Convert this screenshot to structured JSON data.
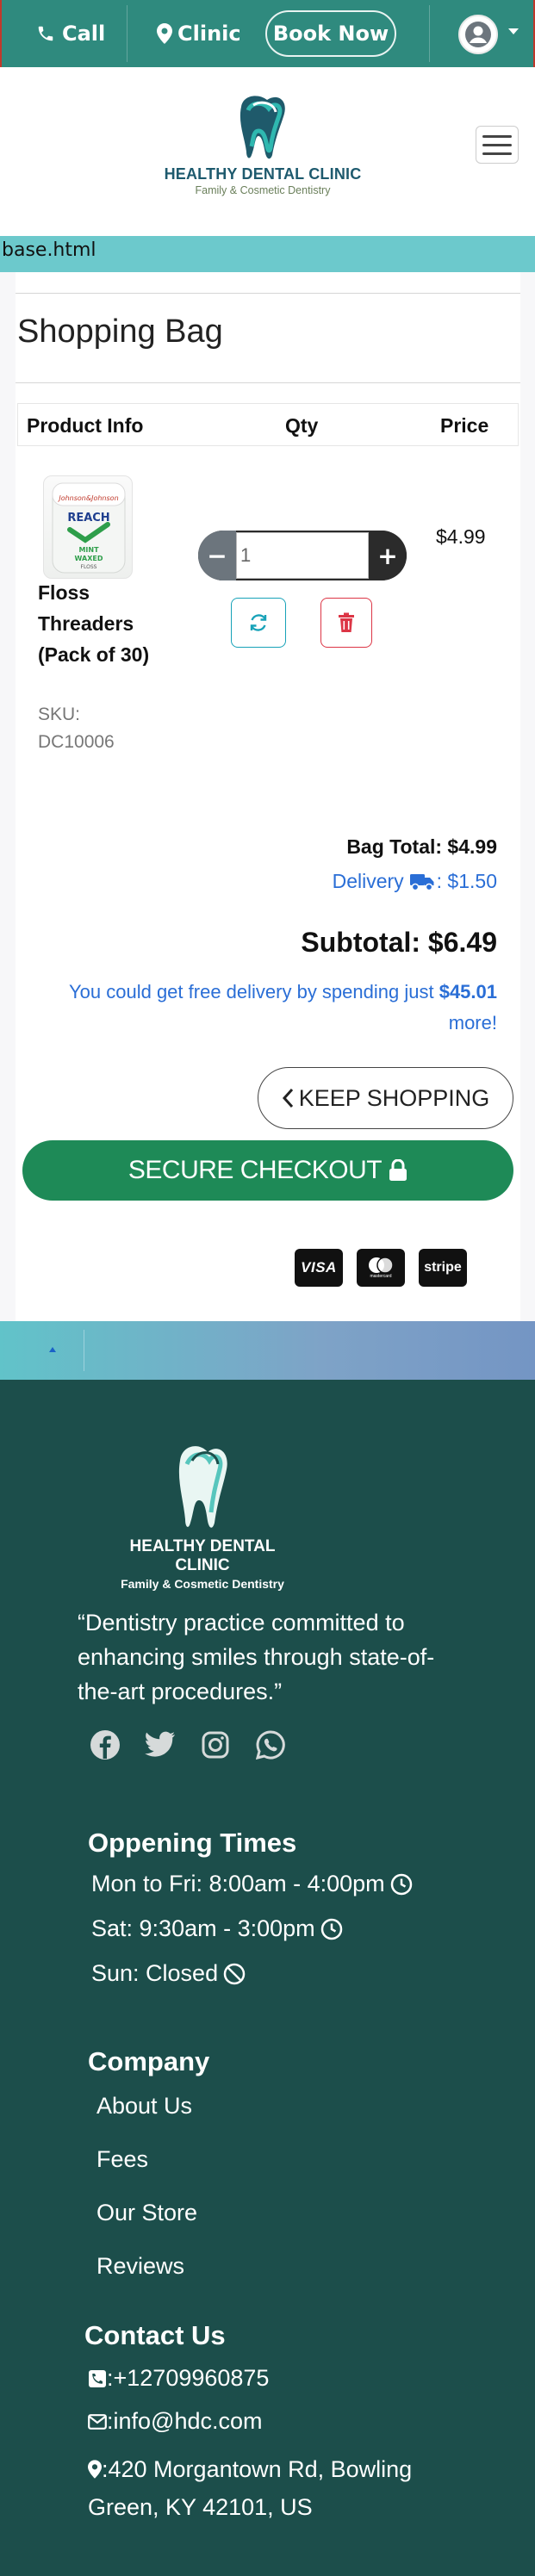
{
  "topbar": {
    "call_label": "Call",
    "clinic_label": "Clinic",
    "book_label": "Book Now",
    "icons": {
      "call": "phone-icon",
      "clinic": "map-marker-icon",
      "user": "user-circle-icon",
      "caret": "caret-down-icon"
    }
  },
  "header": {
    "logo_name": "HEALTHY DENTAL CLINIC",
    "logo_sub": "Family & Cosmetic Dentistry",
    "menu_icon": "hamburger-icon"
  },
  "file_label": "base.html",
  "cart": {
    "title": "Shopping Bag",
    "columns": {
      "product": "Product Info",
      "qty": "Qty",
      "price": "Price"
    },
    "items": [
      {
        "name": "Floss Threaders (Pack of 30)",
        "sku": "SKU: DC10006",
        "qty": "1",
        "price": "$4.99"
      }
    ],
    "qty_minus": "−",
    "qty_plus": "+",
    "bag_total": "Bag Total: $4.99",
    "delivery_label": "Delivery",
    "delivery_value": ": $1.50",
    "subtotal": "Subtotal: $6.49",
    "free_delivery_prefix": "You could get free delivery by spending just",
    "free_delivery_amount": "$45.01",
    "free_delivery_suffix": "more!",
    "keep_shopping": "KEEP SHOPPING",
    "secure_checkout": "SECURE CHECKOUT",
    "payment_methods": [
      "VISA",
      "mastercard",
      "stripe"
    ]
  },
  "footer": {
    "logo_name": "HEALTHY DENTAL CLINIC",
    "logo_sub": "Family & Cosmetic Dentistry",
    "quote": "“Dentistry practice committed to enhancing smiles through state-of-the-art procedures.”",
    "social": [
      "facebook-icon",
      "twitter-icon",
      "instagram-icon",
      "whatsapp-icon"
    ],
    "hours_title": "Oppening Times",
    "hours": [
      "Mon to Fri: 8:00am - 4:00pm",
      "Sat: 9:30am - 3:00pm",
      "Sun: Closed"
    ],
    "company_title": "Company",
    "company_links": [
      "About Us",
      "Fees",
      "Our Store",
      "Reviews"
    ],
    "contact_title": "Contact Us",
    "phone": ":+12709960875",
    "email": ":info@hdc.com",
    "address": ":420 Morgantown Rd, Bowling Green, KY 42101, US"
  },
  "colors": {
    "topbar": "#2f8a7e",
    "footer": "#1c4e4b",
    "checkout": "#1e8a57",
    "link_blue": "#2a6ed6"
  }
}
